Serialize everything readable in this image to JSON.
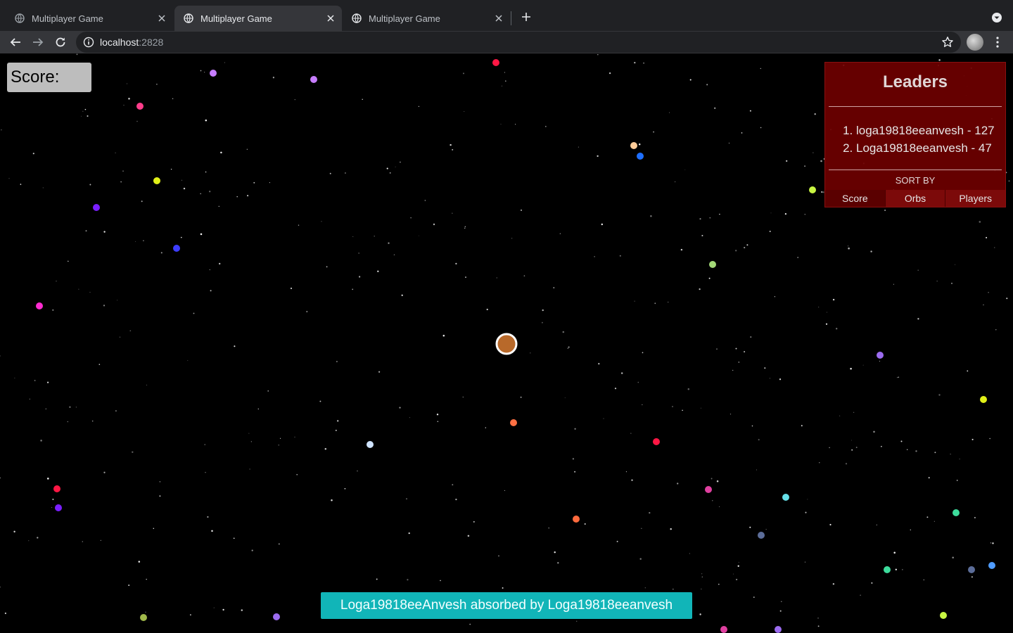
{
  "browser": {
    "tabs": [
      {
        "title": "Multiplayer Game",
        "active": false
      },
      {
        "title": "Multiplayer Game",
        "active": true
      },
      {
        "title": "Multiplayer Game",
        "active": false
      }
    ],
    "url_host": "localhost",
    "url_port": ":2828"
  },
  "game": {
    "score_label": "Score:",
    "player_color": "#b8692a",
    "leaderboard": {
      "title": "Leaders",
      "entries": [
        {
          "text": "loga19818eeanvesh - 127"
        },
        {
          "text": "Loga19818eeanvesh - 47"
        }
      ],
      "sort_label": "SORT BY",
      "sort_options": [
        "Score",
        "Orbs",
        "Players"
      ],
      "selected_sort": "Score"
    },
    "toast": "Loga19818eeAnvesh absorbed by Loga19818eeanvesh",
    "orb_colors": [
      "#c77dff",
      "#ff3d8b",
      "#e1f018",
      "#7a1fff",
      "#3d3dff",
      "#ff2bd0",
      "#ff1744",
      "#ffcc99",
      "#1e6fff",
      "#c8f542",
      "#a3d977",
      "#9c6cf0",
      "#ff7043",
      "#cfe3ff",
      "#ff6a3d",
      "#e040a0",
      "#66e0e8",
      "#5c6d99",
      "#3ddc9c",
      "#4f9cff",
      "#a0b84a"
    ]
  }
}
